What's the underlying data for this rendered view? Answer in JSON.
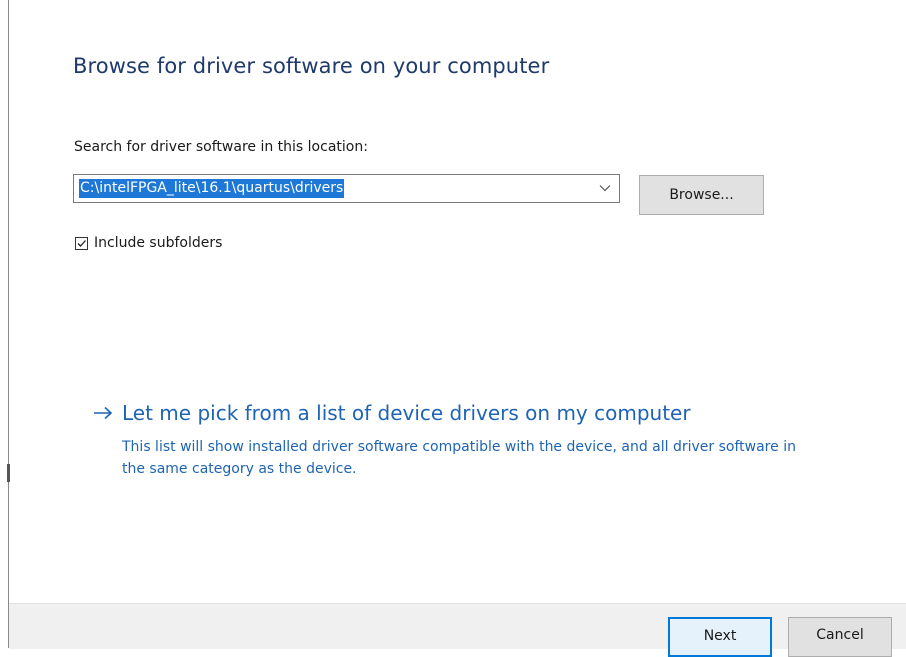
{
  "header": {
    "title": "Browse for driver software on your computer"
  },
  "search": {
    "label": "Search for driver software in this location:",
    "path_value": "C:\\intelFPGA_lite\\16.1\\quartus\\drivers",
    "browse_label": "Browse...",
    "dropdown_icon": "chevron-down-icon"
  },
  "subfolders": {
    "checked": true,
    "label": "Include subfolders"
  },
  "pick_list": {
    "icon": "arrow-right-icon",
    "title": "Let me pick from a list of device drivers on my computer",
    "description": "This list will show installed driver software compatible with the device, and all driver software in the same category as the device."
  },
  "footer": {
    "next_label": "Next",
    "cancel_label": "Cancel"
  },
  "colors": {
    "title": "#1e3a6b",
    "link": "#1e64b4",
    "selection": "#1e78d7",
    "default_button_border": "#0078d7",
    "footer_bg": "#f0f0f0"
  }
}
